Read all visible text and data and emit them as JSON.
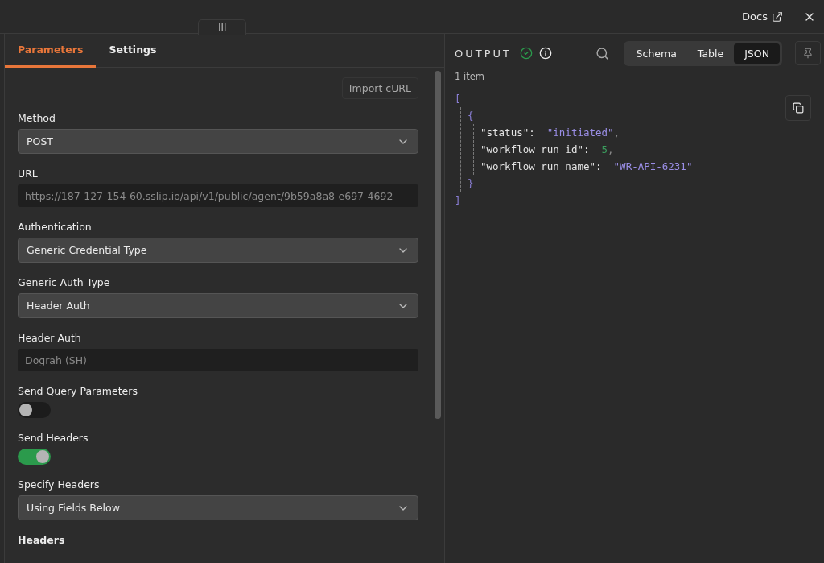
{
  "header": {
    "docs_link": "Docs"
  },
  "params_panel": {
    "tabs": [
      {
        "label": "Parameters",
        "selected": true
      },
      {
        "label": "Settings",
        "selected": false
      }
    ],
    "import_button": "Import cURL",
    "fields": [
      {
        "kind": "select",
        "label": "Method",
        "value": "POST"
      },
      {
        "kind": "input",
        "label": "URL",
        "value": "https://187-127-154-60.sslip.io/api/v1/public/agent/9b59a8a8-e697-4692-"
      },
      {
        "kind": "select",
        "label": "Authentication",
        "value": "Generic Credential Type"
      },
      {
        "kind": "select",
        "label": "Generic Auth Type",
        "value": "Header Auth"
      },
      {
        "kind": "input",
        "label": "Header Auth",
        "value": "Dograh (SH)"
      },
      {
        "kind": "toggle",
        "label": "Send Query Parameters",
        "on": false
      },
      {
        "kind": "toggle",
        "label": "Send Headers",
        "on": true
      },
      {
        "kind": "select",
        "label": "Specify Headers",
        "value": "Using Fields Below"
      },
      {
        "kind": "heading",
        "label": "Headers"
      }
    ]
  },
  "output_panel": {
    "title": "OUTPUT",
    "view_tabs": [
      {
        "label": "Schema",
        "selected": false
      },
      {
        "label": "Table",
        "selected": false
      },
      {
        "label": "JSON",
        "selected": true
      }
    ],
    "item_count": "1 item",
    "json": {
      "open": "[",
      "close": "]",
      "children": [
        {
          "open": "{",
          "close": "}",
          "entries": [
            {
              "key": "\"status\":",
              "value": "\"initiated\"",
              "kind": "string",
              "comma": ","
            },
            {
              "key": "\"workflow_run_id\":",
              "value": "5",
              "kind": "number",
              "comma": ","
            },
            {
              "key": "\"workflow_run_name\":",
              "value": "\"WR-API-6231\"",
              "kind": "string"
            }
          ]
        }
      ]
    }
  }
}
